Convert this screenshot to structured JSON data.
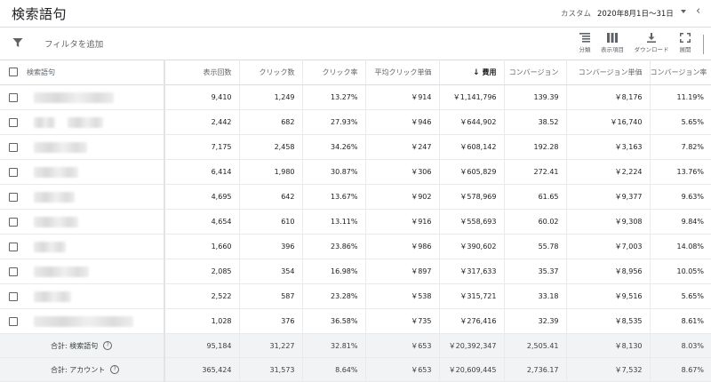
{
  "header": {
    "title": "検索語句",
    "range_label": "カスタム",
    "range_value": "2020年8月1日〜31日",
    "prev_glyph": "‹"
  },
  "toolbar": {
    "filter_label": "フィルタを追加",
    "tools": [
      {
        "label": "分類",
        "icon": "segment-icon"
      },
      {
        "label": "表示項目",
        "icon": "columns-icon"
      },
      {
        "label": "ダウンロード",
        "icon": "download-icon"
      },
      {
        "label": "展開",
        "icon": "expand-icon"
      }
    ]
  },
  "table": {
    "columns": [
      "検索語句",
      "表示回数",
      "クリック数",
      "クリック率",
      "平均クリック単価",
      "費用",
      "コンバージョン",
      "コンバージョン単価",
      "コンバージョン率"
    ],
    "sorted_column_arrow": "↓",
    "rows": [
      {
        "impr": "9,410",
        "clicks": "1,249",
        "ctr": "13.27%",
        "cpc": "￥914",
        "cost": "￥1,141,796",
        "conv": "139.39",
        "cpa": "￥8,176",
        "cvr": "11.19%"
      },
      {
        "impr": "2,442",
        "clicks": "682",
        "ctr": "27.93%",
        "cpc": "￥946",
        "cost": "￥644,902",
        "conv": "38.52",
        "cpa": "￥16,740",
        "cvr": "5.65%"
      },
      {
        "impr": "7,175",
        "clicks": "2,458",
        "ctr": "34.26%",
        "cpc": "￥247",
        "cost": "￥608,142",
        "conv": "192.28",
        "cpa": "￥3,163",
        "cvr": "7.82%"
      },
      {
        "impr": "6,414",
        "clicks": "1,980",
        "ctr": "30.87%",
        "cpc": "￥306",
        "cost": "￥605,829",
        "conv": "272.41",
        "cpa": "￥2,224",
        "cvr": "13.76%"
      },
      {
        "impr": "4,695",
        "clicks": "642",
        "ctr": "13.67%",
        "cpc": "￥902",
        "cost": "￥578,969",
        "conv": "61.65",
        "cpa": "￥9,377",
        "cvr": "9.63%"
      },
      {
        "impr": "4,654",
        "clicks": "610",
        "ctr": "13.11%",
        "cpc": "￥916",
        "cost": "￥558,693",
        "conv": "60.02",
        "cpa": "￥9,308",
        "cvr": "9.84%"
      },
      {
        "impr": "1,660",
        "clicks": "396",
        "ctr": "23.86%",
        "cpc": "￥986",
        "cost": "￥390,602",
        "conv": "55.78",
        "cpa": "￥7,003",
        "cvr": "14.08%"
      },
      {
        "impr": "2,085",
        "clicks": "354",
        "ctr": "16.98%",
        "cpc": "￥897",
        "cost": "￥317,633",
        "conv": "35.37",
        "cpa": "￥8,956",
        "cvr": "10.05%"
      },
      {
        "impr": "2,522",
        "clicks": "587",
        "ctr": "23.28%",
        "cpc": "￥538",
        "cost": "￥315,721",
        "conv": "33.18",
        "cpa": "￥9,516",
        "cvr": "5.65%"
      },
      {
        "impr": "1,028",
        "clicks": "376",
        "ctr": "36.58%",
        "cpc": "￥735",
        "cost": "￥276,416",
        "conv": "32.39",
        "cpa": "￥8,535",
        "cvr": "8.61%"
      }
    ],
    "totals": [
      {
        "label": "合計: 検索語句",
        "impr": "95,184",
        "clicks": "31,227",
        "ctr": "32.81%",
        "cpc": "￥653",
        "cost": "￥20,392,347",
        "conv": "2,505.41",
        "cpa": "￥8,130",
        "cvr": "8.03%"
      },
      {
        "label": "合計: アカウント",
        "impr": "365,424",
        "clicks": "31,573",
        "ctr": "8.64%",
        "cpc": "￥653",
        "cost": "￥20,609,445",
        "conv": "2,736.17",
        "cpa": "￥7,532",
        "cvr": "8.67%"
      }
    ],
    "help_glyph": "?"
  }
}
